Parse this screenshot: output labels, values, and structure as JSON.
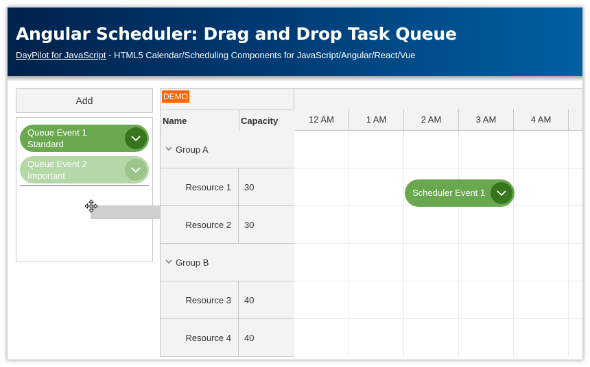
{
  "header": {
    "title": "Angular Scheduler: Drag and Drop Task Queue",
    "link_text": "DayPilot for JavaScript",
    "subtitle_rest": " - HTML5 Calendar/Scheduling Components for JavaScript/Angular/React/Vue"
  },
  "queue": {
    "add_label": "Add",
    "items": [
      {
        "line1": "Queue Event 1",
        "line2": "Standard",
        "color": "#6aa84f",
        "button_icon": "chevron-down-icon"
      },
      {
        "line1": "Queue Event 2",
        "line2": "Important",
        "color": "#b6d7a8",
        "button_icon": "chevron-down-icon"
      }
    ],
    "cursor_icon": "move-cursor-icon"
  },
  "scheduler": {
    "demo_badge": "DEMO",
    "columns": {
      "name": "Name",
      "capacity": "Capacity"
    },
    "hours": [
      "12 AM",
      "1 AM",
      "2 AM",
      "3 AM",
      "4 AM"
    ],
    "groups": [
      {
        "name": "Group A",
        "resources": [
          {
            "name": "Resource 1",
            "capacity": "30"
          },
          {
            "name": "Resource 2",
            "capacity": "30"
          }
        ]
      },
      {
        "name": "Group B",
        "resources": [
          {
            "name": "Resource 3",
            "capacity": "40"
          },
          {
            "name": "Resource 4",
            "capacity": "40"
          }
        ]
      }
    ],
    "event": {
      "text": "Scheduler Event 1",
      "resource": "Resource 1",
      "start": "2 AM",
      "end": "4 AM",
      "color": "#6aa84f"
    }
  },
  "colors": {
    "accent_green": "#6aa84f",
    "dark_green": "#38761d",
    "demo_orange": "#ff6600"
  }
}
